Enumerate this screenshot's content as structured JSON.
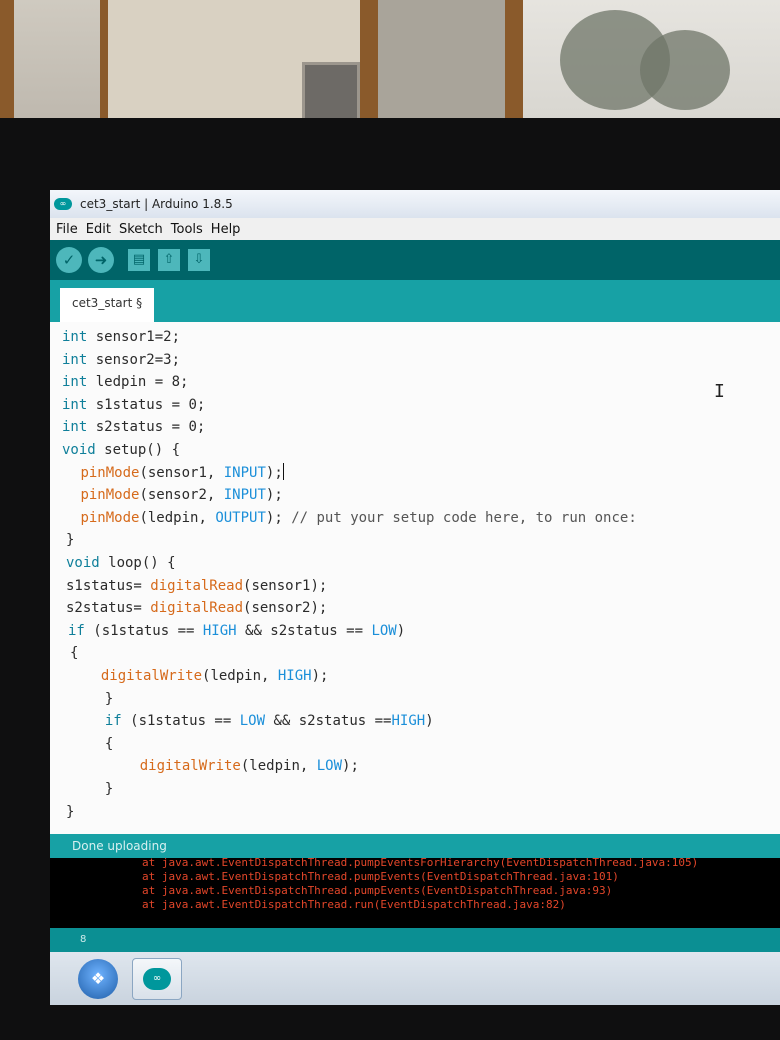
{
  "window": {
    "title": "cet3_start | Arduino 1.8.5",
    "logo": "arduino-infinity-icon"
  },
  "menu": [
    "File",
    "Edit",
    "Sketch",
    "Tools",
    "Help"
  ],
  "toolbar": {
    "buttons": [
      {
        "name": "verify",
        "icon": "check-icon",
        "glyph": "✓"
      },
      {
        "name": "upload",
        "icon": "arrow-right-icon",
        "glyph": "➜"
      },
      {
        "name": "new",
        "icon": "file-icon",
        "glyph": "▤"
      },
      {
        "name": "open",
        "icon": "arrow-up-icon",
        "glyph": "⇧"
      },
      {
        "name": "save",
        "icon": "arrow-down-icon",
        "glyph": "⇩"
      }
    ]
  },
  "tab": {
    "label": "cet3_start §"
  },
  "code": [
    "int sensor1=2;",
    "int sensor2=3;",
    "int ledpin = 8;",
    "int s1status = 0;",
    "int s2status = 0;",
    "void setup() {",
    " pinMode(sensor1, INPUT);",
    " pinMode(sensor2, INPUT);",
    " pinMode(ledpin, OUTPUT); // put your setup code here, to run once:",
    "}",
    "void loop() {",
    "s1status= digitalRead(sensor1);",
    "s2status= digitalRead(sensor2);",
    "if (s1status == HIGH && s2status == LOW)",
    "{",
    "  digitalWrite(ledpin, HIGH);",
    "  }",
    "  if (s1status == LOW && s2status ==HIGH)",
    "  {",
    "    digitalWrite(ledpin, LOW);",
    "  }",
    "}"
  ],
  "status": {
    "message": "Done uploading"
  },
  "console": [
    "at java.awt.EventDispatchThread.pumpEventsForHierarchy(EventDispatchThread.java:105)",
    "at java.awt.EventDispatchThread.pumpEvents(EventDispatchThread.java:101)",
    "at java.awt.EventDispatchThread.pumpEvents(EventDispatchThread.java:93)",
    "at java.awt.EventDispatchThread.run(EventDispatchThread.java:82)"
  ],
  "console_footer": "8",
  "colors": {
    "teal_dark": "#006468",
    "teal": "#17a1a5",
    "error_text": "#e3462a"
  }
}
